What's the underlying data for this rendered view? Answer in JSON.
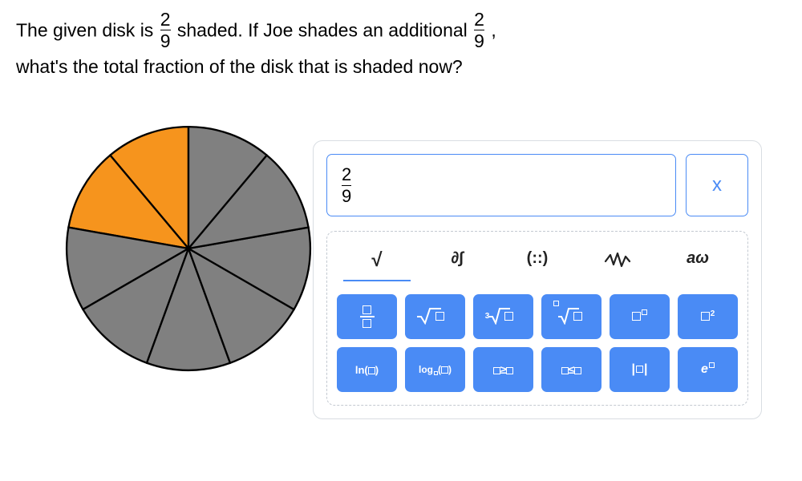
{
  "question": {
    "part1": "The given disk is",
    "frac1": {
      "n": "2",
      "d": "9"
    },
    "part2": "shaded. If Joe shades an additional",
    "frac2": {
      "n": "2",
      "d": "9"
    },
    "part3": ",",
    "line2": "what's the total fraction of the disk that is shaded now?"
  },
  "disk": {
    "slices": 9,
    "shaded": 2,
    "color_shaded": "#f6941d",
    "color_unshaded": "#808080"
  },
  "answer": {
    "n": "2",
    "d": "9"
  },
  "x_button": "x",
  "tabs": {
    "t0": "√",
    "t1": "∂∫",
    "t2": "(::)",
    "t3": "wiggle",
    "t4": "aω"
  },
  "keys": {
    "r1c3": "√▢",
    "r1c4": "∛▢",
    "r1c5": "ᵒ√▢",
    "r2c1": "ln(▢)",
    "r2c2": "log▫(▢)",
    "r2c3": "▢≥▢",
    "r2c4": "▢≤▢",
    "r2c5": "|▢|",
    "r2c6_base": "e"
  }
}
